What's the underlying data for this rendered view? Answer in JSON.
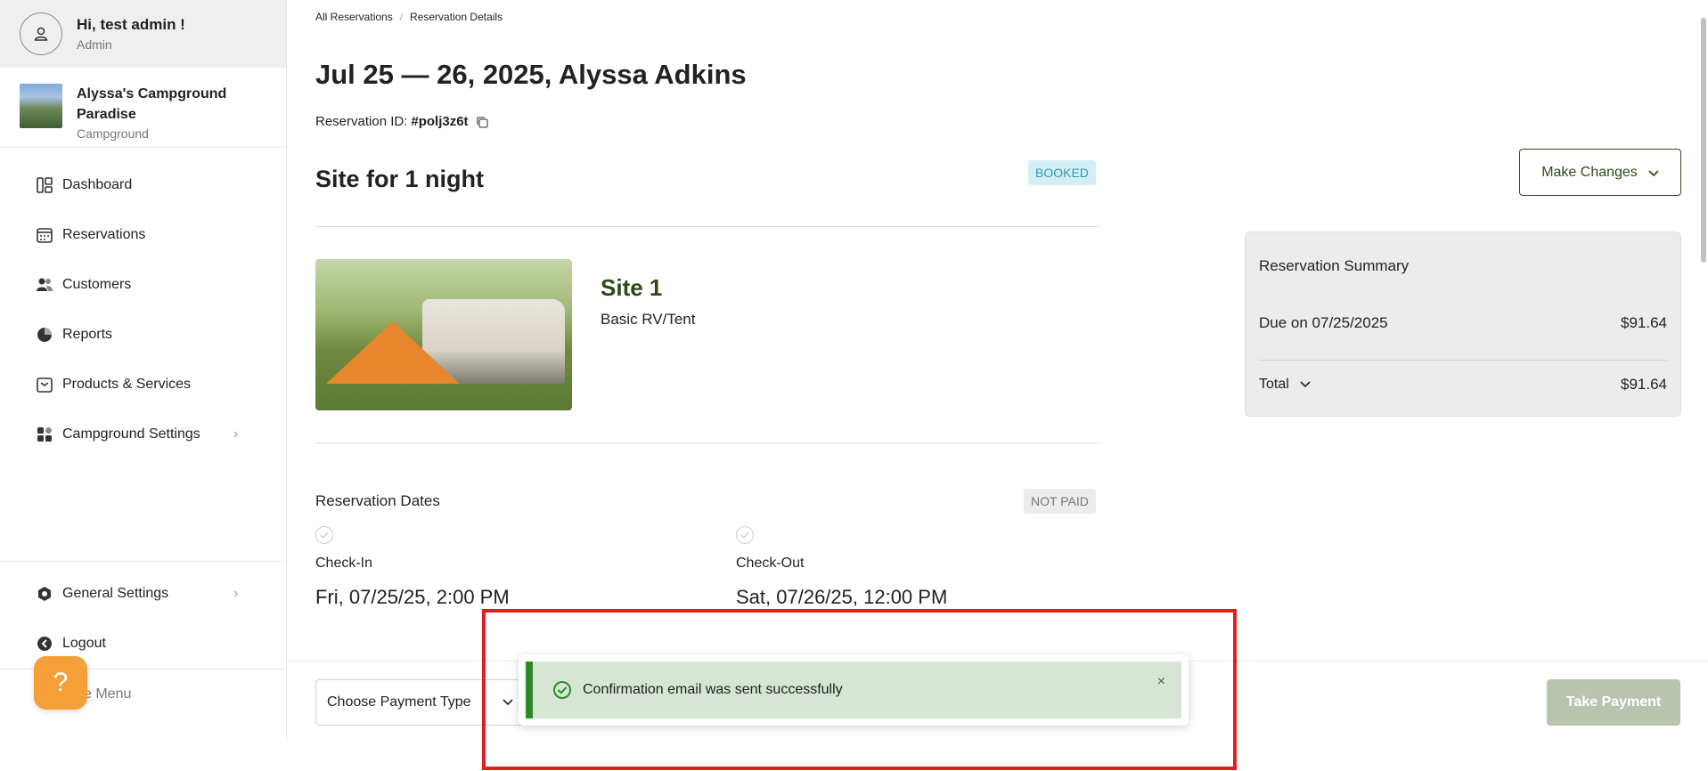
{
  "user": {
    "greeting": "Hi, test admin !",
    "role": "Admin"
  },
  "campground": {
    "name": "Alyssa's Campground Paradise",
    "type": "Campground"
  },
  "nav": {
    "dashboard": "Dashboard",
    "reservations": "Reservations",
    "customers": "Customers",
    "reports": "Reports",
    "products": "Products & Services",
    "campground_settings": "Campground Settings",
    "general_settings": "General Settings",
    "logout": "Logout",
    "hide_menu": "Hide Menu"
  },
  "breadcrumb": {
    "root": "All Reservations",
    "separator": "/",
    "current": "Reservation Details"
  },
  "reservation": {
    "title": "Jul 25 — 26, 2025, Alyssa Adkins",
    "id_label": "Reservation ID:",
    "id_value": "#polj3z6t",
    "site_heading": "Site for 1 night",
    "status": "BOOKED",
    "site_name": "Site 1",
    "site_type": "Basic RV/Tent",
    "dates_title": "Reservation Dates",
    "payment_status": "NOT PAID",
    "checkin_label": "Check-In",
    "checkin_value": "Fri, 07/25/25, 2:00 PM",
    "checkout_label": "Check-Out",
    "checkout_value": "Sat, 07/26/25, 12:00 PM"
  },
  "actions": {
    "make_changes": "Make Changes",
    "take_payment": "Take Payment",
    "payment_type_placeholder": "Choose Payment Type"
  },
  "summary": {
    "title": "Reservation Summary",
    "due_label": "Due on 07/25/2025",
    "due_value": "$91.64",
    "total_label": "Total",
    "total_value": "$91.64"
  },
  "toast": {
    "message": "Confirmation email was sent successfully",
    "close": "×"
  },
  "colors": {
    "accent": "#2d4a17",
    "success": "#2e8b24",
    "highlight": "#e0201f",
    "help": "#f5a036"
  }
}
